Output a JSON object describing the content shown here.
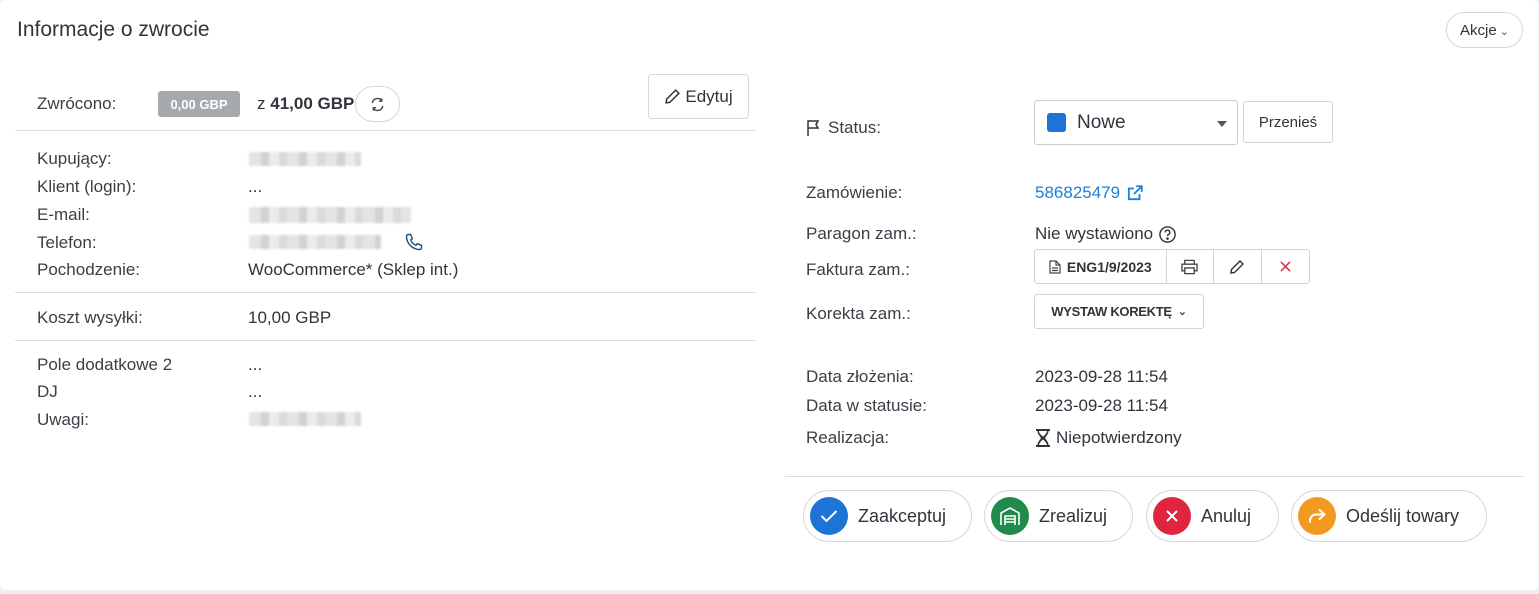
{
  "header": {
    "title": "Informacje o zwrocie",
    "actions_label": "Akcje"
  },
  "refund": {
    "label": "Zwrócono:",
    "badge": "0,00 GBP",
    "of_prefix": "z",
    "total": "41,00 GBP",
    "edit_label": "Edytuj"
  },
  "buyer": {
    "kupujacy_label": "Kupujący:",
    "klient_label": "Klient (login):",
    "klient_value": "...",
    "email_label": "E-mail:",
    "telefon_label": "Telefon:",
    "pochodzenie_label": "Pochodzenie:",
    "pochodzenie_value": "WooCommerce* (Sklep int.)"
  },
  "shipping": {
    "label": "Koszt wysyłki:",
    "value": "10,00 GBP"
  },
  "extra": {
    "pole_label": "Pole dodatkowe 2",
    "pole_value": "...",
    "dj_label": "DJ",
    "dj_value": "...",
    "uwagi_label": "Uwagi:"
  },
  "status": {
    "label": "Status:",
    "selected": "Nowe",
    "selected_color": "#1e73d6",
    "move_label": "Przenieś"
  },
  "order": {
    "zamowienie_label": "Zamówienie:",
    "zamowienie_value": "586825479",
    "paragon_label": "Paragon zam.:",
    "paragon_value": "Nie wystawiono",
    "faktura_label": "Faktura zam.:",
    "faktura_value": "ENG1/9/2023",
    "korekta_label": "Korekta zam.:",
    "korekta_button": "WYSTAW KOREKTĘ"
  },
  "dates": {
    "zlozenia_label": "Data złożenia:",
    "zlozenia_value": "2023-09-28 11:54",
    "status_label": "Data w statusie:",
    "status_value": "2023-09-28 11:54",
    "realizacja_label": "Realizacja:",
    "realizacja_value": "Niepotwierdzony"
  },
  "actions": {
    "accept": {
      "label": "Zaakceptuj",
      "color": "#1e73d6"
    },
    "realize": {
      "label": "Zrealizuj",
      "color": "#1f8a4c"
    },
    "cancel": {
      "label": "Anuluj",
      "color": "#e0253f"
    },
    "send_back": {
      "label": "Odeślij towary",
      "color": "#f29a1f"
    }
  }
}
